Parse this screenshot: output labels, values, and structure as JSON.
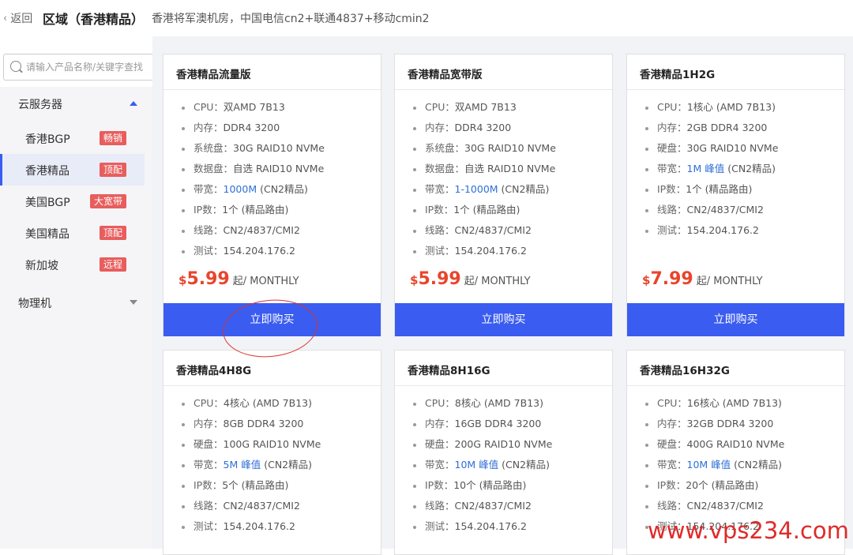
{
  "topbar": {
    "back_label": "返回",
    "title": "区域（香港精品）",
    "description": "香港将军澳机房，中国电信cn2+联通4837+移动cmin2"
  },
  "sidebar": {
    "search_placeholder": "请输入产品名称/关键字查找",
    "group_cloud": "云服务器",
    "items": [
      {
        "label": "香港BGP",
        "badge": "畅销"
      },
      {
        "label": "香港精品",
        "badge": "顶配"
      },
      {
        "label": "美国BGP",
        "badge": "大宽带"
      },
      {
        "label": "美国精品",
        "badge": "顶配"
      },
      {
        "label": "新加坡",
        "badge": "远程"
      }
    ],
    "group_physical": "物理机"
  },
  "cards": [
    {
      "title": "香港精品流量版",
      "specs": [
        {
          "k": "CPU：",
          "v": "双AMD 7B13"
        },
        {
          "k": "内存：",
          "v": "DDR4 3200"
        },
        {
          "k": "系统盘：",
          "v": "30G RAID10 NVMe"
        },
        {
          "k": "数据盘：",
          "v": "自选 RAID10 NVMe"
        },
        {
          "k": "带宽：",
          "v": "1000M",
          "suffix": " (CN2精品)"
        },
        {
          "k": "IP数：",
          "v": "1个 (精品路由)"
        },
        {
          "k": "线路：",
          "v": "CN2/4837/CMI2"
        },
        {
          "k": "测试：",
          "v": "154.204.176.2"
        }
      ],
      "currency": "$",
      "price": "5.99",
      "unit": "起/ MONTHLY",
      "buy": "立即购买"
    },
    {
      "title": "香港精品宽带版",
      "specs": [
        {
          "k": "CPU：",
          "v": "双AMD 7B13"
        },
        {
          "k": "内存：",
          "v": "DDR4 3200"
        },
        {
          "k": "系统盘：",
          "v": "30G RAID10 NVMe"
        },
        {
          "k": "数据盘：",
          "v": "自选 RAID10 NVMe"
        },
        {
          "k": "带宽：",
          "v": "1-1000M",
          "suffix": " (CN2精品)"
        },
        {
          "k": "IP数：",
          "v": "1个 (精品路由)"
        },
        {
          "k": "线路：",
          "v": "CN2/4837/CMI2"
        },
        {
          "k": "测试：",
          "v": "154.204.176.2"
        }
      ],
      "currency": "$",
      "price": "5.99",
      "unit": "起/ MONTHLY",
      "buy": "立即购买"
    },
    {
      "title": "香港精品1H2G",
      "specs": [
        {
          "k": "CPU：",
          "v": "1核心 (AMD 7B13)"
        },
        {
          "k": "内存：",
          "v": "2GB DDR4 3200"
        },
        {
          "k": "硬盘：",
          "v": "30G RAID10 NVMe"
        },
        {
          "k": "带宽：",
          "v": "1M 峰值",
          "suffix": " (CN2精品)"
        },
        {
          "k": "IP数：",
          "v": "1个 (精品路由)"
        },
        {
          "k": "线路：",
          "v": "CN2/4837/CMI2"
        },
        {
          "k": "测试：",
          "v": "154.204.176.2"
        }
      ],
      "currency": "$",
      "price": "7.99",
      "unit": "起/ MONTHLY",
      "buy": "立即购买"
    },
    {
      "title": "香港精品4H8G",
      "specs": [
        {
          "k": "CPU：",
          "v": "4核心 (AMD 7B13)"
        },
        {
          "k": "内存：",
          "v": "8GB DDR4 3200"
        },
        {
          "k": "硬盘：",
          "v": "100G RAID10 NVMe"
        },
        {
          "k": "带宽：",
          "v": "5M 峰值",
          "suffix": " (CN2精品)"
        },
        {
          "k": "IP数：",
          "v": "5个 (精品路由)"
        },
        {
          "k": "线路：",
          "v": "CN2/4837/CMI2"
        },
        {
          "k": "测试：",
          "v": "154.204.176.2"
        }
      ]
    },
    {
      "title": "香港精品8H16G",
      "specs": [
        {
          "k": "CPU：",
          "v": "8核心 (AMD 7B13)"
        },
        {
          "k": "内存：",
          "v": "16GB DDR4 3200"
        },
        {
          "k": "硬盘：",
          "v": "200G RAID10 NVMe"
        },
        {
          "k": "带宽：",
          "v": "10M 峰值",
          "suffix": " (CN2精品)"
        },
        {
          "k": "IP数：",
          "v": "10个 (精品路由)"
        },
        {
          "k": "线路：",
          "v": "CN2/4837/CMI2"
        },
        {
          "k": "测试：",
          "v": "154.204.176.2"
        }
      ]
    },
    {
      "title": "香港精品16H32G",
      "specs": [
        {
          "k": "CPU：",
          "v": "16核心 (AMD 7B13)"
        },
        {
          "k": "内存：",
          "v": "32GB DDR4 3200"
        },
        {
          "k": "硬盘：",
          "v": "400G RAID10 NVMe"
        },
        {
          "k": "带宽：",
          "v": "10M 峰值",
          "suffix": " (CN2精品)"
        },
        {
          "k": "IP数：",
          "v": "20个 (精品路由)"
        },
        {
          "k": "线路：",
          "v": "CN2/4837/CMI2"
        },
        {
          "k": "测试：",
          "v": "154.204.176.2"
        }
      ]
    }
  ],
  "watermark": "www.vps234.com",
  "colors": {
    "accent": "#3a5cf0",
    "price": "#e8452c",
    "badge": "#e85d5d",
    "highlight": "#2f6fd8"
  }
}
